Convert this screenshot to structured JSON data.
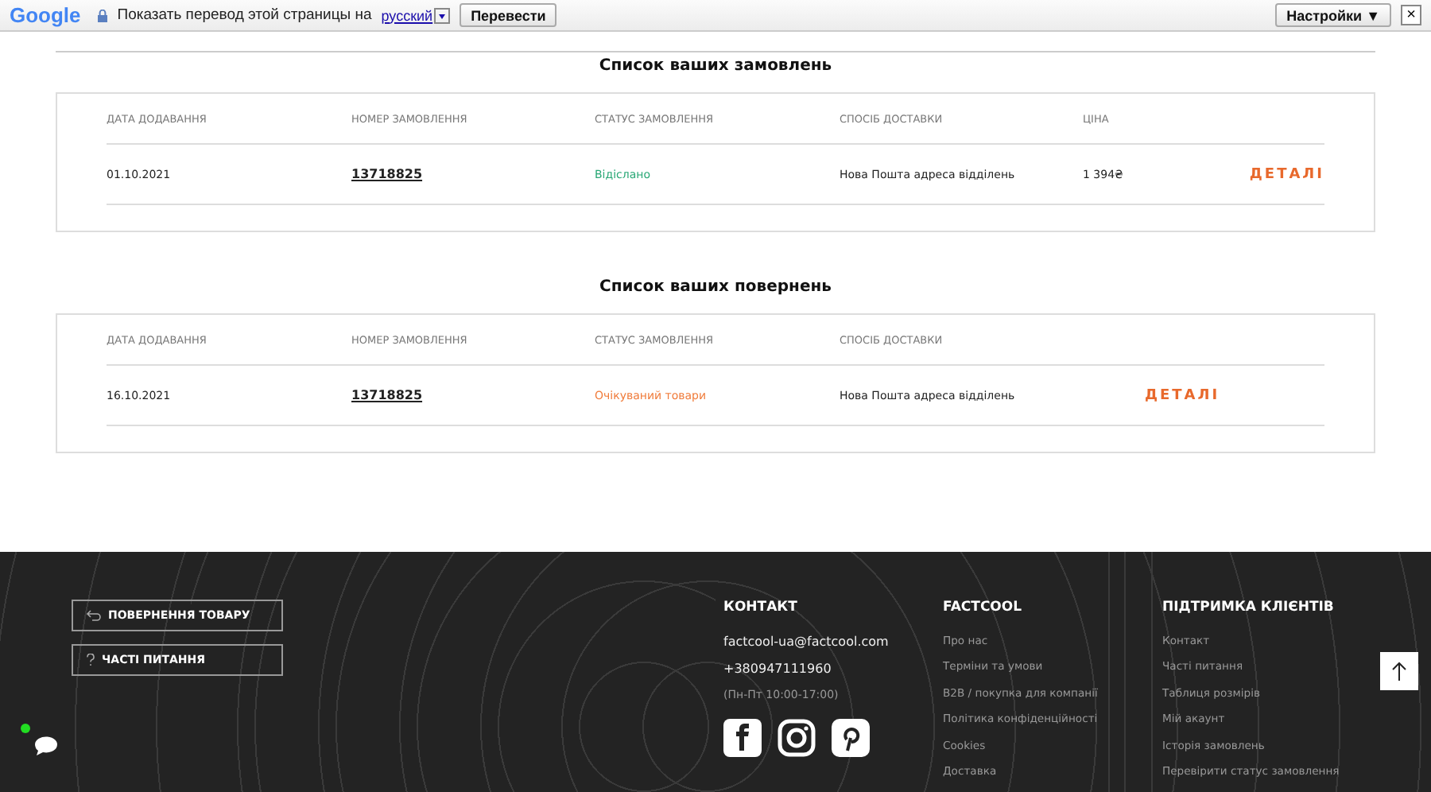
{
  "translate_bar": {
    "logo": "Google",
    "prompt": "Показать перевод этой страницы на",
    "language": "русский",
    "translate_button": "Перевести",
    "settings_button": "Настройки ▼",
    "close": "×"
  },
  "orders": {
    "title": "Список ваших замовлень",
    "columns": [
      "ДАТА ДОДАВАННЯ",
      "НОМЕР ЗАМОВЛЕННЯ",
      "СТАТУС ЗАМОВЛЕННЯ",
      "СПОСІБ ДОСТАВКИ",
      "ЦІНА"
    ],
    "rows": [
      {
        "cells": [
          {
            "kind": "text",
            "text": "01.10.2021"
          },
          {
            "kind": "order",
            "text": "13718825"
          },
          {
            "kind": "status",
            "text": "Відіслано",
            "color": "#2aa876"
          },
          {
            "kind": "text",
            "text": "Нова Пошта адреса відділень"
          },
          {
            "kind": "text",
            "text": "1 394₴"
          },
          {
            "kind": "details",
            "text": "ДЕТАЛІ"
          }
        ]
      }
    ]
  },
  "returns": {
    "title": "Список ваших повернень",
    "columns": [
      "ДАТА ДОДАВАННЯ",
      "НОМЕР ЗАМОВЛЕННЯ",
      "СТАТУС ЗАМОВЛЕННЯ",
      "СПОСІБ ДОСТАВКИ"
    ],
    "rows": [
      {
        "cells": [
          {
            "kind": "text",
            "text": "16.10.2021"
          },
          {
            "kind": "order",
            "text": "13718825"
          },
          {
            "kind": "status",
            "text": "Очікуваний товари",
            "color": "#f07b3a"
          },
          {
            "kind": "text",
            "text": "Нова Пошта адреса відділень"
          },
          {
            "kind": "details",
            "text": "ДЕТАЛІ"
          }
        ]
      }
    ]
  },
  "footer": {
    "buttons": [
      {
        "kind": "return",
        "label": "ПОВЕРНЕННЯ ТОВАРУ"
      },
      {
        "kind": "faq",
        "label": "ЧАСТІ ПИТАННЯ"
      }
    ],
    "contact": {
      "title": "КОНТАКТ",
      "email": "factcool-ua@factcool.com",
      "phone": "+380947111960",
      "hours": "(Пн-Пт 10:00-17:00)"
    },
    "factcool": {
      "title": "FACTCOOL",
      "links": [
        "Про нас",
        "Терміни та умови",
        "B2B / покупка для компанії",
        "Політика конфіденційності",
        "Cookies",
        "Доставка"
      ]
    },
    "support": {
      "title": "ПІДТРИМКА КЛІЄНТІВ",
      "links": [
        "Контакт",
        "Часті питання",
        "Таблиця розмірів",
        "Мій акаунт",
        "Історія замовлень",
        "Перевірити статус замовлення"
      ]
    }
  }
}
